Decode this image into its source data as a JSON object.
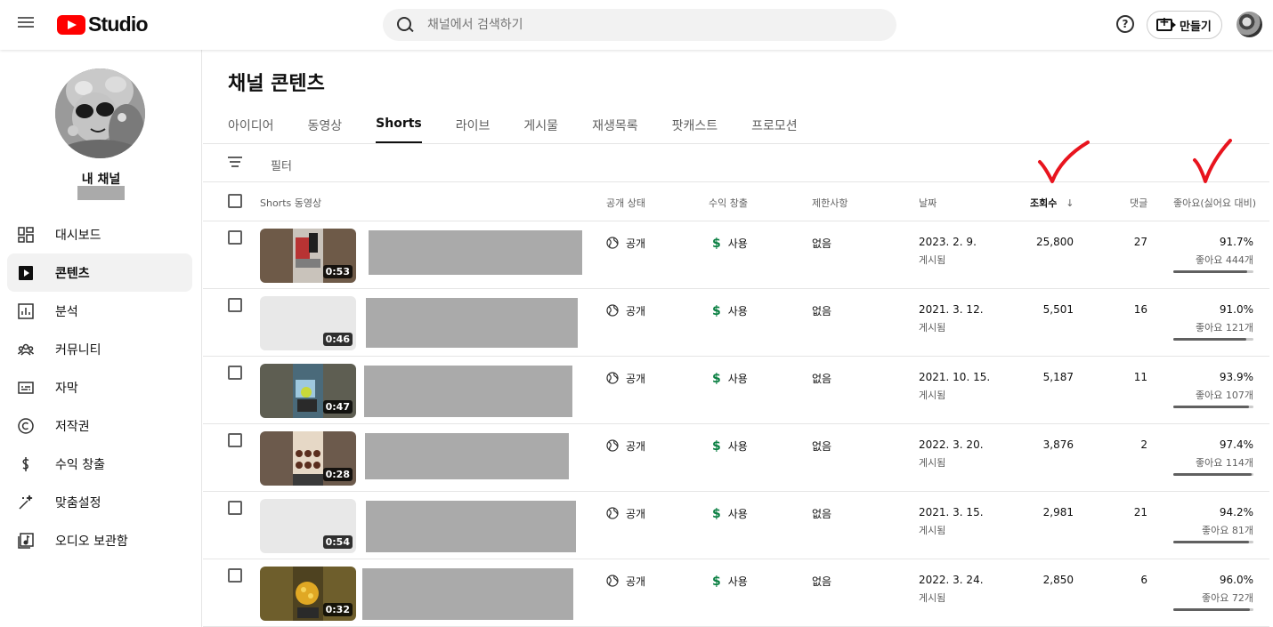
{
  "app": {
    "logo_text": "Studio"
  },
  "search": {
    "placeholder": "채널에서 검색하기"
  },
  "header": {
    "help": "?",
    "create_label": "만들기"
  },
  "channel": {
    "name": "내 채널"
  },
  "sidebar": {
    "items": [
      {
        "label": "대시보드",
        "icon": "dashboard-icon",
        "active": false
      },
      {
        "label": "콘텐츠",
        "icon": "content-icon",
        "active": true
      },
      {
        "label": "분석",
        "icon": "analytics-icon",
        "active": false
      },
      {
        "label": "커뮤니티",
        "icon": "community-icon",
        "active": false
      },
      {
        "label": "자막",
        "icon": "subtitles-icon",
        "active": false
      },
      {
        "label": "저작권",
        "icon": "copyright-icon",
        "active": false
      },
      {
        "label": "수익 창출",
        "icon": "monetization-icon",
        "active": false
      },
      {
        "label": "맞춤설정",
        "icon": "customization-icon",
        "active": false
      },
      {
        "label": "오디오 보관함",
        "icon": "audio-library-icon",
        "active": false
      }
    ]
  },
  "main": {
    "title": "채널 콘텐츠",
    "tabs": [
      {
        "label": "아이디어",
        "active": false
      },
      {
        "label": "동영상",
        "active": false
      },
      {
        "label": "Shorts",
        "active": true
      },
      {
        "label": "라이브",
        "active": false
      },
      {
        "label": "게시물",
        "active": false
      },
      {
        "label": "재생목록",
        "active": false
      },
      {
        "label": "팟캐스트",
        "active": false
      },
      {
        "label": "프로모션",
        "active": false
      }
    ],
    "filter_label": "필터"
  },
  "table": {
    "headers": {
      "video": "Shorts 동영상",
      "visibility": "공개 상태",
      "monetization": "수익 창출",
      "restrictions": "제한사항",
      "date": "날짜",
      "views": "조회수",
      "comments": "댓글",
      "likes": "좋아요(싫어요 대비)"
    },
    "sort_indicator": "↓",
    "rows": [
      {
        "duration": "0:53",
        "visibility": "공개",
        "monetization": "사용",
        "restrictions": "없음",
        "date": "2023. 2. 9.",
        "date_status": "게시됨",
        "views": "25,800",
        "comments": "27",
        "like_pct": "91.7%",
        "like_count": "좋아요 444개",
        "like_ratio": 0.917
      },
      {
        "duration": "0:46",
        "visibility": "공개",
        "monetization": "사용",
        "restrictions": "없음",
        "date": "2021. 3. 12.",
        "date_status": "게시됨",
        "views": "5,501",
        "comments": "16",
        "like_pct": "91.0%",
        "like_count": "좋아요 121개",
        "like_ratio": 0.91
      },
      {
        "duration": "0:47",
        "visibility": "공개",
        "monetization": "사용",
        "restrictions": "없음",
        "date": "2021. 10. 15.",
        "date_status": "게시됨",
        "views": "5,187",
        "comments": "11",
        "like_pct": "93.9%",
        "like_count": "좋아요 107개",
        "like_ratio": 0.939
      },
      {
        "duration": "0:28",
        "visibility": "공개",
        "monetization": "사용",
        "restrictions": "없음",
        "date": "2022. 3. 20.",
        "date_status": "게시됨",
        "views": "3,876",
        "comments": "2",
        "like_pct": "97.4%",
        "like_count": "좋아요 114개",
        "like_ratio": 0.974
      },
      {
        "duration": "0:54",
        "visibility": "공개",
        "monetization": "사용",
        "restrictions": "없음",
        "date": "2021. 3. 15.",
        "date_status": "게시됨",
        "views": "2,981",
        "comments": "21",
        "like_pct": "94.2%",
        "like_count": "좋아요 81개",
        "like_ratio": 0.942
      },
      {
        "duration": "0:32",
        "visibility": "공개",
        "monetization": "사용",
        "restrictions": "없음",
        "date": "2022. 3. 24.",
        "date_status": "게시됨",
        "views": "2,850",
        "comments": "6",
        "like_pct": "96.0%",
        "like_count": "좋아요 72개",
        "like_ratio": 0.96
      }
    ]
  },
  "colors": {
    "brand": "#ff0000",
    "monetization_green": "#0b8043",
    "annotation_red": "#e8141e"
  }
}
